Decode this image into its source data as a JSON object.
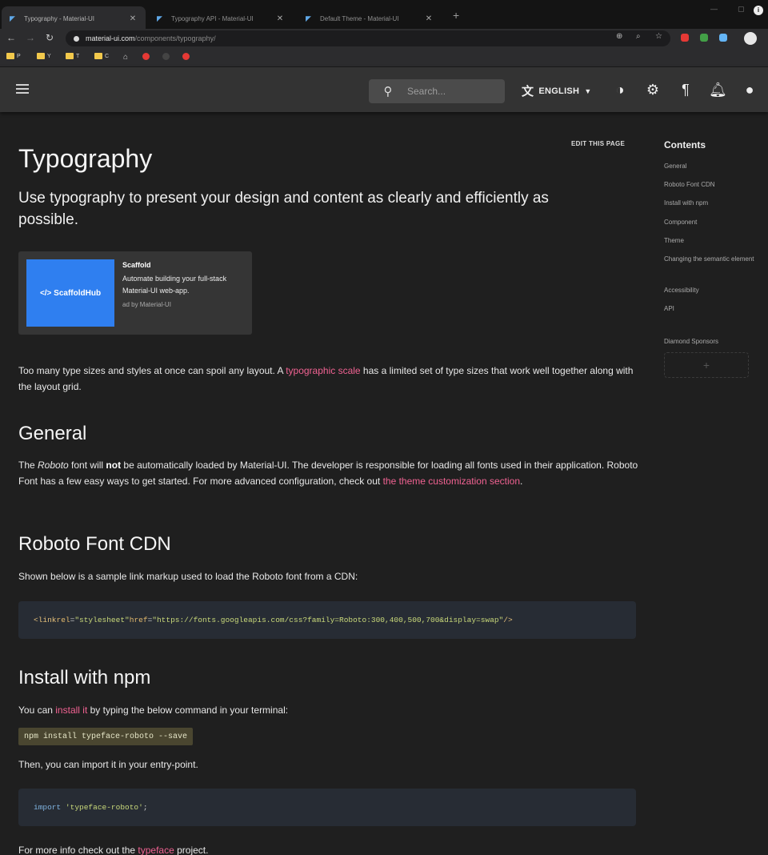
{
  "browser": {
    "tabs": [
      {
        "title": "Typography - Material-UI",
        "active": true
      },
      {
        "title": "Typography API - Material-UI",
        "active": false
      },
      {
        "title": "Default Theme - Material-UI",
        "active": false
      }
    ],
    "url_host": "material-ui.com",
    "url_path": "/components/typography/",
    "bookmarks": [
      "P",
      "Y",
      "T",
      "C"
    ]
  },
  "appbar": {
    "search_placeholder": "Search...",
    "language": "ENGLISH"
  },
  "page": {
    "edit_link": "EDIT THIS PAGE",
    "title": "Typography",
    "subtitle": "Use typography to present your design and content as clearly and efficiently as possible.",
    "ad": {
      "image_text": "</> ScaffoldHub",
      "title": "Scaffold",
      "description": "Automate building your full-stack Material-UI web-app.",
      "byline": "ad by Material-UI"
    },
    "intro": {
      "before": "Too many type sizes and styles at once can spoil any layout. A ",
      "link": "typographic scale",
      "after": " has a limited set of type sizes that work well together along with the layout grid."
    },
    "general": {
      "heading": "General",
      "t1": "The ",
      "roboto": "Roboto",
      "t2": " font will ",
      "not": "not",
      "t3": " be automatically loaded by Material-UI. The developer is responsible for loading all fonts used in their application. Roboto Font has a few easy ways to get started. For more advanced configuration, check out ",
      "link": "the theme customization section",
      "t4": "."
    },
    "cdn": {
      "heading": "Roboto Font CDN",
      "text": "Shown below is a sample link markup used to load the Roboto font from a CDN:",
      "code": {
        "open": "<link ",
        "attr1": "rel",
        "eq1": "=",
        "val1": "\"stylesheet\"",
        "attr2": " href",
        "eq2": "=",
        "val2": "\"https://fonts.googleapis.com/css?family=Roboto:300,400,500,700&display=swap\"",
        "close": " />"
      }
    },
    "npm": {
      "heading": "Install with npm",
      "t1": "You can ",
      "link": "install it",
      "t2": " by typing the below command in your terminal:",
      "command": "npm install typeface-roboto --save",
      "then": "Then, you can import it in your entry-point.",
      "import_kw": "import",
      "import_str": "'typeface-roboto'",
      "import_end": ";",
      "more_before": "For more info check out the ",
      "more_link": "typeface",
      "more_after": " project."
    }
  },
  "toc": {
    "title": "Contents",
    "items": [
      "General",
      "Roboto Font CDN",
      "Install with npm",
      "Component",
      "Theme",
      "Changing the semantic element",
      "Accessibility",
      "API"
    ],
    "sponsors_label": "Diamond Sponsors",
    "sponsor_placeholder": "+"
  },
  "colors": {
    "link": "#f06292",
    "background": "#1f1f1f",
    "appbar": "#333333",
    "ad_image": "#2f7ff0"
  }
}
